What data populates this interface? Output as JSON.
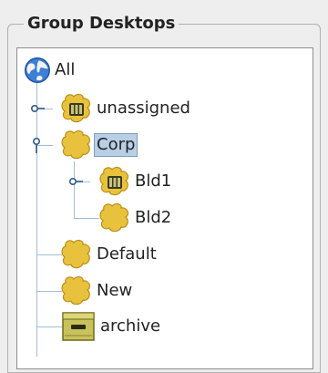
{
  "panel": {
    "title": "Group Desktops"
  },
  "tree": {
    "root": {
      "label": "All",
      "icon": "globe-icon"
    },
    "items": [
      {
        "label": "unassigned",
        "icon": "group-with-desktops-icon",
        "expanded": false
      },
      {
        "label": "Corp",
        "icon": "group-icon",
        "expanded": true,
        "selected": true
      },
      {
        "label": "Bld1",
        "icon": "group-with-desktops-icon",
        "expanded": false
      },
      {
        "label": "Bld2",
        "icon": "group-icon"
      },
      {
        "label": "Default",
        "icon": "group-icon"
      },
      {
        "label": "New",
        "icon": "group-icon"
      },
      {
        "label": "archive",
        "icon": "archive-icon"
      }
    ]
  },
  "colors": {
    "selection": "#b8cfe5",
    "tree_lines": "#a5bdd8",
    "group_icon": "#e9c23d",
    "archive_icon": "#c8c25a"
  }
}
